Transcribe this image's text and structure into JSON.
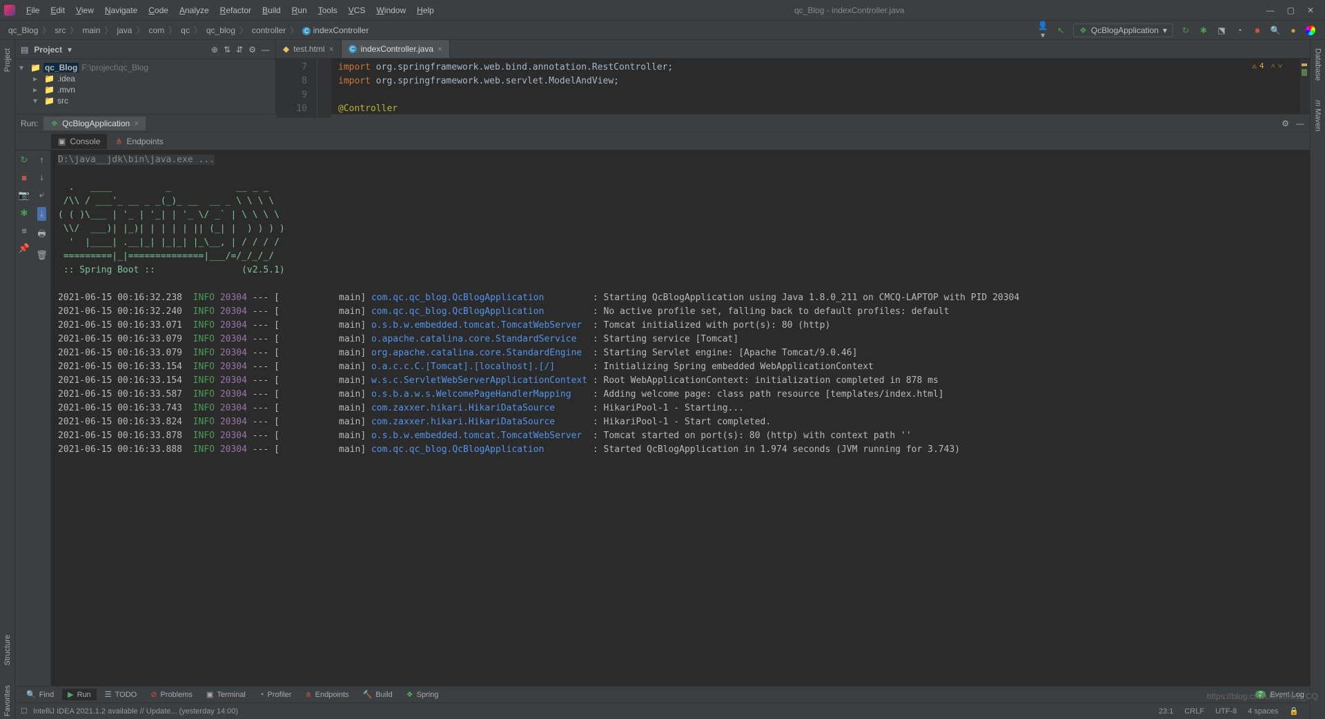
{
  "menu": [
    "File",
    "Edit",
    "View",
    "Navigate",
    "Code",
    "Analyze",
    "Refactor",
    "Build",
    "Run",
    "Tools",
    "VCS",
    "Window",
    "Help"
  ],
  "window_title": "qc_Blog - indexController.java",
  "breadcrumb": [
    "qc_Blog",
    "src",
    "main",
    "java",
    "com",
    "qc",
    "qc_blog",
    "controller",
    "indexController"
  ],
  "run_config": "QcBlogApplication",
  "project": {
    "title": "Project",
    "root_name": "qc_Blog",
    "root_path": "F:\\project\\qc_Blog",
    "nodes": [
      ".idea",
      ".mvn",
      "src"
    ]
  },
  "editor": {
    "tabs": [
      {
        "name": "test.html",
        "active": false
      },
      {
        "name": "indexController.java",
        "active": true
      }
    ],
    "line_start": 7,
    "lines": [
      {
        "n": "7",
        "t": "import org.springframework.web.bind.annotation.RestController;"
      },
      {
        "n": "8",
        "t": "import org.springframework.web.servlet.ModelAndView;"
      },
      {
        "n": "9",
        "t": ""
      },
      {
        "n": "10",
        "t": "@Controller",
        "ann": true,
        "run": true
      }
    ],
    "warn": "4"
  },
  "run": {
    "label": "Run:",
    "tab": "QcBlogApplication",
    "subtabs": [
      "Console",
      "Endpoints"
    ],
    "cmd": "D:\\java__jdk\\bin\\java.exe ...",
    "banner": "  .   ____          _            __ _ _\n /\\\\ / ___'_ __ _ _(_)_ __  __ _ \\ \\ \\ \\\n( ( )\\___ | '_ | '_| | '_ \\/ _` | \\ \\ \\ \\\n \\\\/  ___)| |_)| | | | | || (_| |  ) ) ) )\n  '  |____| .__|_| |_|_| |_\\__, | / / / /\n =========|_|==============|___/=/_/_/_/\n :: Spring Boot ::                (v2.5.1)",
    "logs": [
      {
        "ts": "2021-06-15 00:16:32.238",
        "lvl": "INFO",
        "pid": "20304",
        "th": "main",
        "src": "com.qc.qc_blog.QcBlogApplication",
        "msg": "Starting QcBlogApplication using Java 1.8.0_211 on CMCQ-LAPTOP with PID 20304"
      },
      {
        "ts": "2021-06-15 00:16:32.240",
        "lvl": "INFO",
        "pid": "20304",
        "th": "main",
        "src": "com.qc.qc_blog.QcBlogApplication",
        "msg": "No active profile set, falling back to default profiles: default"
      },
      {
        "ts": "2021-06-15 00:16:33.071",
        "lvl": "INFO",
        "pid": "20304",
        "th": "main",
        "src": "o.s.b.w.embedded.tomcat.TomcatWebServer",
        "msg": "Tomcat initialized with port(s): 80 (http)"
      },
      {
        "ts": "2021-06-15 00:16:33.079",
        "lvl": "INFO",
        "pid": "20304",
        "th": "main",
        "src": "o.apache.catalina.core.StandardService",
        "msg": "Starting service [Tomcat]"
      },
      {
        "ts": "2021-06-15 00:16:33.079",
        "lvl": "INFO",
        "pid": "20304",
        "th": "main",
        "src": "org.apache.catalina.core.StandardEngine",
        "msg": "Starting Servlet engine: [Apache Tomcat/9.0.46]"
      },
      {
        "ts": "2021-06-15 00:16:33.154",
        "lvl": "INFO",
        "pid": "20304",
        "th": "main",
        "src": "o.a.c.c.C.[Tomcat].[localhost].[/]",
        "msg": "Initializing Spring embedded WebApplicationContext"
      },
      {
        "ts": "2021-06-15 00:16:33.154",
        "lvl": "INFO",
        "pid": "20304",
        "th": "main",
        "src": "w.s.c.ServletWebServerApplicationContext",
        "msg": "Root WebApplicationContext: initialization completed in 878 ms"
      },
      {
        "ts": "2021-06-15 00:16:33.587",
        "lvl": "INFO",
        "pid": "20304",
        "th": "main",
        "src": "o.s.b.a.w.s.WelcomePageHandlerMapping",
        "msg": "Adding welcome page: class path resource [templates/index.html]"
      },
      {
        "ts": "2021-06-15 00:16:33.743",
        "lvl": "INFO",
        "pid": "20304",
        "th": "main",
        "src": "com.zaxxer.hikari.HikariDataSource",
        "msg": "HikariPool-1 - Starting..."
      },
      {
        "ts": "2021-06-15 00:16:33.824",
        "lvl": "INFO",
        "pid": "20304",
        "th": "main",
        "src": "com.zaxxer.hikari.HikariDataSource",
        "msg": "HikariPool-1 - Start completed."
      },
      {
        "ts": "2021-06-15 00:16:33.878",
        "lvl": "INFO",
        "pid": "20304",
        "th": "main",
        "src": "o.s.b.w.embedded.tomcat.TomcatWebServer",
        "msg": "Tomcat started on port(s): 80 (http) with context path ''"
      },
      {
        "ts": "2021-06-15 00:16:33.888",
        "lvl": "INFO",
        "pid": "20304",
        "th": "main",
        "src": "com.qc.qc_blog.QcBlogApplication",
        "msg": "Started QcBlogApplication in 1.974 seconds (JVM running for 3.743)"
      }
    ]
  },
  "left_tabs": [
    "Project"
  ],
  "left_tabs_bottom": [
    "Structure",
    "Favorites"
  ],
  "right_tabs": [
    "Database",
    "Maven"
  ],
  "bottom": {
    "tabs": [
      "Find",
      "Run",
      "TODO",
      "Problems",
      "Terminal",
      "Profiler",
      "Endpoints",
      "Build",
      "Spring"
    ],
    "event_log": "Event Log",
    "event_count": "2"
  },
  "status": {
    "left": "IntelliJ IDEA 2021.1.2 available // Update... (yesterday 14:00)",
    "pos": "23:1",
    "crlf": "CRLF",
    "enc": "UTF-8",
    "indent": "4 spaces"
  },
  "watermark": "https://blog.csdn.net/chirp_CQ"
}
